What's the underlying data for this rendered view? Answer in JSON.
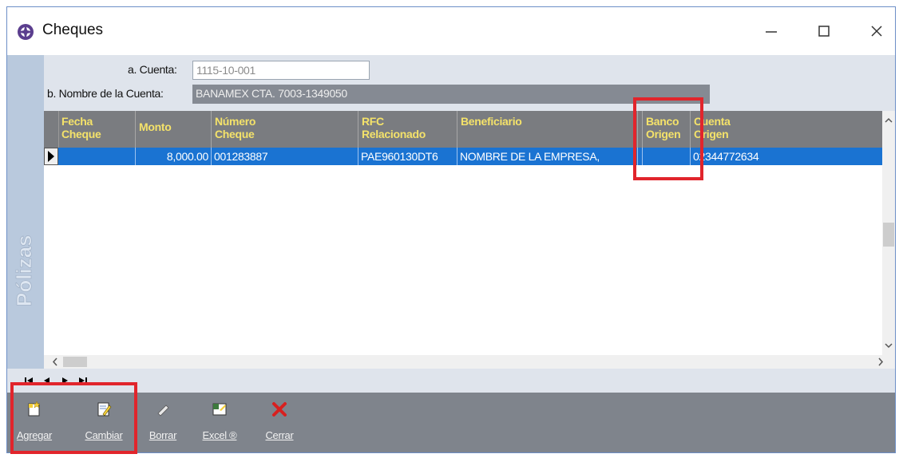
{
  "window": {
    "title": "Cheques"
  },
  "titlebar_buttons": [
    "minimize",
    "maximize",
    "close"
  ],
  "side_tab": {
    "label": "Pólizas"
  },
  "header": {
    "cuenta_label": "a. Cuenta:",
    "cuenta_value": "1115-10-001",
    "nombre_label": "b. Nombre de la Cuenta:",
    "nombre_value": "BANAMEX CTA. 7003-1349050"
  },
  "grid": {
    "columns": [
      {
        "line1": "Fecha",
        "line2": "Cheque"
      },
      {
        "line1": "Monto",
        "line2": ""
      },
      {
        "line1": "Número",
        "line2": "Cheque"
      },
      {
        "line1": "RFC",
        "line2": "Relacionado"
      },
      {
        "line1": "Beneficiario",
        "line2": ""
      },
      {
        "line1": "",
        "line2": ""
      },
      {
        "line1": "Banco",
        "line2": "Origen"
      },
      {
        "line1": "Cuenta",
        "line2": "Origen"
      }
    ],
    "rows": [
      {
        "fecha": "",
        "monto": "8,000.00",
        "numero": "001283887",
        "rfc": "PAE960130DT6",
        "beneficiario": "NOMBRE DE LA EMPRESA,",
        "extra": "",
        "banco": "",
        "cuenta": "02344772634"
      }
    ]
  },
  "toolbar": {
    "agregar": "Agregar",
    "cambiar": "Cambiar",
    "borrar": "Borrar",
    "excel": "Excel ®",
    "cerrar": "Cerrar"
  },
  "colors": {
    "header_bg": "#7a7c80",
    "header_text": "#f4e26a",
    "selected_row": "#1a73d2",
    "highlight": "#e1252c",
    "toolbar_bg": "#7f848c"
  }
}
